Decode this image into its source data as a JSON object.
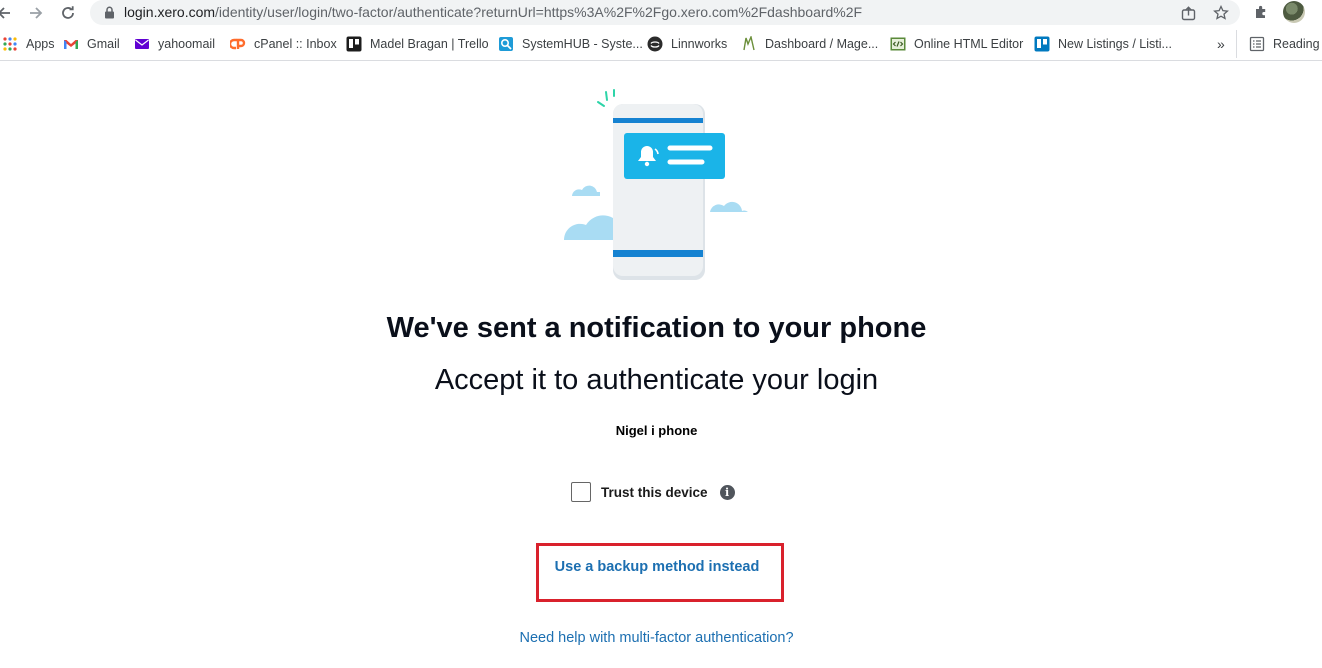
{
  "browser": {
    "url_host": "login.xero.com",
    "url_path": "/identity/user/login/two-factor/authenticate?returnUrl=https%3A%2F%2Fgo.xero.com%2Fdashboard%2F",
    "bookmarks": [
      {
        "label": "Apps"
      },
      {
        "label": "Gmail"
      },
      {
        "label": "yahoomail"
      },
      {
        "label": "cPanel :: Inbox"
      },
      {
        "label": "Madel Bragan | Trello"
      },
      {
        "label": "SystemHUB - Syste..."
      },
      {
        "label": "Linnworks"
      },
      {
        "label": "Dashboard / Mage..."
      },
      {
        "label": "Online HTML Editor"
      },
      {
        "label": "New Listings / Listi..."
      }
    ],
    "more_bookmarks": "»",
    "reading_list": "Reading l"
  },
  "page": {
    "title": "We've sent a notification to your phone",
    "subtitle": "Accept it to authenticate your login",
    "device_name": "Nigel i phone",
    "trust_label": "Trust this device",
    "backup_link": "Use a backup method instead",
    "help_link": "Need help with multi-factor authentication?"
  },
  "colors": {
    "link": "#1c6fb1",
    "highlight_box": "#d9212c",
    "illustration_blue": "#1ab4e8"
  },
  "icons": [
    "back-icon",
    "forward-icon",
    "reload-icon",
    "lock-icon",
    "share-icon",
    "star-icon",
    "extensions-icon",
    "info-icon",
    "bell-icon"
  ]
}
